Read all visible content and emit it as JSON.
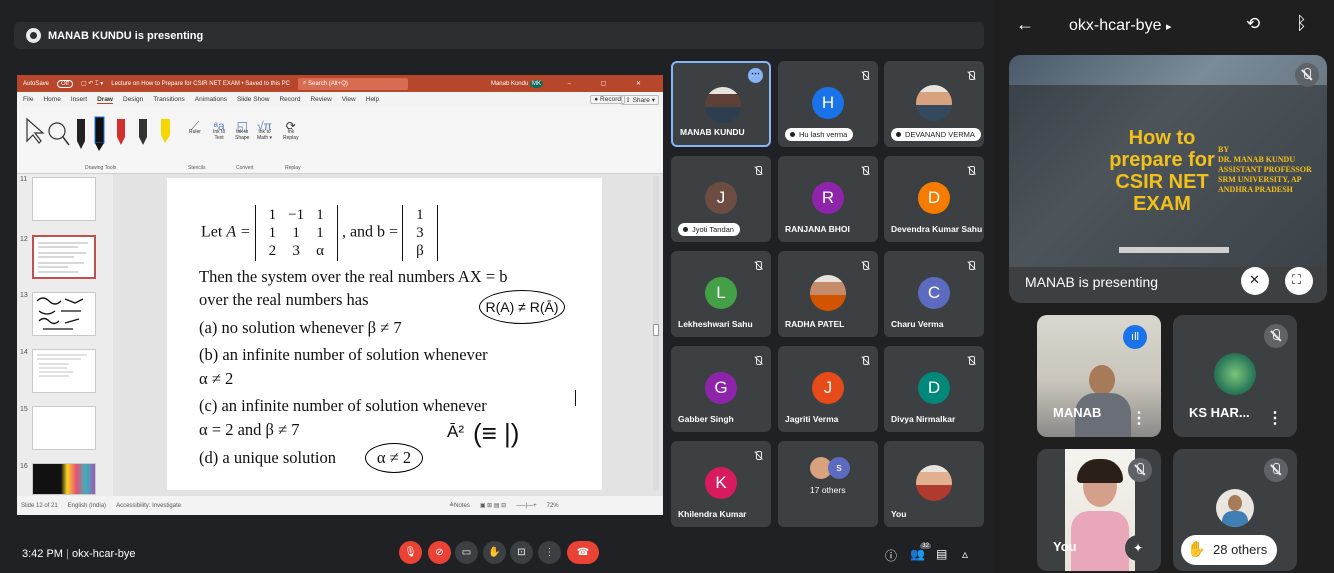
{
  "presenting_bar": {
    "text": "MANAB KUNDU is presenting"
  },
  "ppt": {
    "autosave": "AutoSave",
    "autosave_state": "Off",
    "doc_title": "Lecture on How to Prepare for CSIR NET EXAM  •  Saved to this PC",
    "search": "Search (Alt+Q)",
    "user": "Manab Kundu",
    "user_initials": "MK",
    "menu": [
      "File",
      "Home",
      "Insert",
      "Draw",
      "Design",
      "Transitions",
      "Animations",
      "Slide Show",
      "Record",
      "Review",
      "View",
      "Help"
    ],
    "active_menu": "Draw",
    "record_btn": "Record",
    "share_btn": "Share",
    "ribbon_groups": [
      "Drawing Tools",
      "Stencils",
      "Convert",
      "Replay"
    ],
    "ribbon_tools": [
      {
        "name": "Ruler",
        "line2": ""
      },
      {
        "name": "Ink to",
        "line2": "Text"
      },
      {
        "name": "Ink to",
        "line2": "Shape"
      },
      {
        "name": "Ink to",
        "line2": "Math"
      },
      {
        "name": "Ink",
        "line2": "Replay"
      }
    ],
    "slide_numbers": [
      "11",
      "12",
      "13",
      "14",
      "15",
      "16"
    ],
    "status": {
      "slide": "Slide 12 of 21",
      "language": "English (India)",
      "accessibility": "Accessibility: Investigate",
      "notes": "Notes",
      "zoom": "72%"
    }
  },
  "slide": {
    "let": "Let",
    "a_eq": "A =",
    "matrix_a": [
      [
        "1",
        "−1",
        "1"
      ],
      [
        "1",
        "1",
        "1"
      ],
      [
        "2",
        "3",
        "α"
      ]
    ],
    "and_b": ", and b =",
    "matrix_b": [
      "1",
      "3",
      "β"
    ],
    "line1": "Then the system over the real numbers AX = b",
    "line2": "over the real numbers has",
    "opt_a": "(a) no solution whenever β ≠ 7",
    "opt_b1": "(b) an infinite number of solution whenever",
    "opt_b2": "α ≠ 2",
    "opt_c1": "(c) an infinite number of solution whenever",
    "opt_c2": "α = 2 and β ≠ 7",
    "opt_d": "(d) a unique solution",
    "opt_d_cond": "α ≠ 2",
    "ink_rank": "R(A) ≠ R(Ā)",
    "ink_a2": "Ā²",
    "ink_eq": "(≡ |)"
  },
  "tiles": [
    {
      "name": "MANAB KUNDU",
      "type": "photo",
      "pill": false,
      "speaking": true
    },
    {
      "name": "Hu lash verma",
      "letter": "H",
      "color": "#1a73e8",
      "pill": true
    },
    {
      "name": "DEVANAND VERMA",
      "type": "photo",
      "pill": true
    },
    {
      "name": "Jyoti Tandan",
      "letter": "J",
      "color": "#6d4c41",
      "pill": true
    },
    {
      "name": "RANJANA BHOI",
      "letter": "R",
      "color": "#8e24aa",
      "pill": false
    },
    {
      "name": "Devendra Kumar Sahu",
      "letter": "D",
      "color": "#f57c00",
      "pill": false
    },
    {
      "name": "Lekheshwari Sahu",
      "letter": "L",
      "color": "#43a047",
      "pill": false
    },
    {
      "name": "RADHA PATEL",
      "type": "photo",
      "pill": false
    },
    {
      "name": "Charu Verma",
      "letter": "C",
      "color": "#5c6bc0",
      "pill": false
    },
    {
      "name": "Gabber Singh",
      "letter": "G",
      "color": "#8e24aa",
      "pill": false
    },
    {
      "name": "Jagriti Verma",
      "letter": "J",
      "color": "#e64a19",
      "pill": false
    },
    {
      "name": "Divya Nirmalkar",
      "letter": "D",
      "color": "#00897b",
      "pill": false
    },
    {
      "name": "Khilendra Kumar",
      "letter": "K",
      "color": "#d81b60",
      "pill": false
    },
    {
      "name": "17 others",
      "type": "others",
      "pill": false
    },
    {
      "name": "You",
      "type": "photo",
      "pill": false
    }
  ],
  "bottom": {
    "time": "3:42 PM",
    "separator": "|",
    "code": "okx-hcar-bye",
    "participants_badge": "32"
  },
  "phone": {
    "code": "okx-hcar-bye",
    "caret": "▸",
    "presenting": "MANAB is presenting",
    "slide_title": "How to prepare for CSIR NET EXAM",
    "slide_by": [
      "BY",
      "DR. MANAB KUNDU",
      "ASSISTANT PROFESSOR",
      "SRM UNIVERSITY, AP",
      "ANDHRA PRADESH"
    ],
    "tiles": [
      "MANAB",
      "KS HAR...",
      "You",
      "28 others"
    ]
  },
  "colors": {
    "ppt_accent": "#b7472a",
    "meet_bg": "#202124",
    "tile_bg": "#3c4043",
    "end_call": "#ea4335",
    "speaking": "#8ab4f8"
  }
}
